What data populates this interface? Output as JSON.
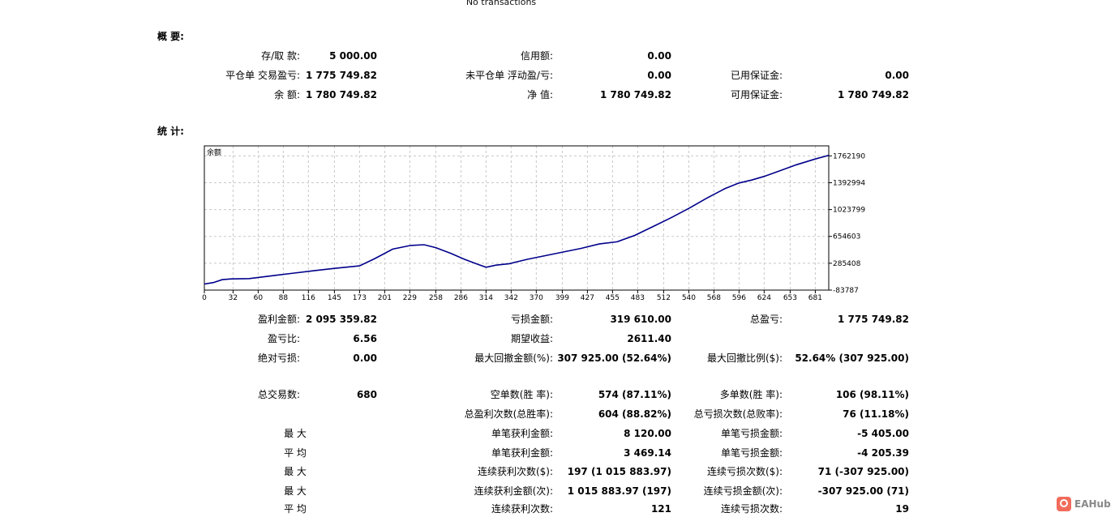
{
  "top_note": "No transactions",
  "summary": {
    "title": "概 要:",
    "rows": [
      [
        {
          "label": "存/取 款:",
          "value": "5 000.00"
        },
        {
          "label": "信用额:",
          "value": "0.00"
        },
        {
          "label": "",
          "value": ""
        }
      ],
      [
        {
          "label": "平仓单 交易盈亏:",
          "value": "1 775 749.82"
        },
        {
          "label": "未平仓单 浮动盈/亏:",
          "value": "0.00"
        },
        {
          "label": "已用保证金:",
          "value": "0.00"
        }
      ],
      [
        {
          "label": "余 额:",
          "value": "1 780 749.82"
        },
        {
          "label": "净 值:",
          "value": "1 780 749.82"
        },
        {
          "label": "可用保证金:",
          "value": "1 780 749.82"
        }
      ]
    ]
  },
  "stats": {
    "title": "统 计:",
    "rows": [
      [
        {
          "label": "盈利金额:",
          "value": "2 095 359.82"
        },
        {
          "label": "亏损金额:",
          "value": "319 610.00"
        },
        {
          "label": "总盈亏:",
          "value": "1 775 749.82"
        }
      ],
      [
        {
          "label": "盈亏比:",
          "value": "6.56"
        },
        {
          "label": "期望收益:",
          "value": "2611.40"
        },
        {
          "label": "",
          "value": ""
        }
      ],
      [
        {
          "label": "绝对亏损:",
          "value": "0.00"
        },
        {
          "label": "最大回撤金额(%):",
          "value": "307 925.00 (52.64%)"
        },
        {
          "label": "最大回撤比例($):",
          "value": "52.64% (307 925.00)"
        }
      ],
      [
        {
          "label": "总交易数:",
          "value": "680"
        },
        {
          "label": "空单数(胜 率):",
          "value": "574 (87.11%)"
        },
        {
          "label": "多单数(胜 率):",
          "value": "106 (98.11%)"
        }
      ],
      [
        {
          "label": "",
          "value": ""
        },
        {
          "label": "总盈利次数(总胜率):",
          "value": "604 (88.82%)"
        },
        {
          "label": "总亏损次数(总败率):",
          "value": "76 (11.18%)"
        }
      ],
      [
        {
          "label": "最 大",
          "value": ""
        },
        {
          "label": "单笔获利金额:",
          "value": "8 120.00"
        },
        {
          "label": "单笔亏损金额:",
          "value": "-5 405.00"
        }
      ],
      [
        {
          "label": "平 均",
          "value": ""
        },
        {
          "label": "单笔获利金额:",
          "value": "3 469.14"
        },
        {
          "label": "单笔亏损金额:",
          "value": "-4 205.39"
        }
      ],
      [
        {
          "label": "最 大",
          "value": ""
        },
        {
          "label": "连续获利次数($):",
          "value": "197 (1 015 883.97)"
        },
        {
          "label": "连续亏损次数($):",
          "value": "71 (-307 925.00)"
        }
      ],
      [
        {
          "label": "最 大",
          "value": ""
        },
        {
          "label": "连续获利金额(次):",
          "value": "1 015 883.97 (197)"
        },
        {
          "label": "连续亏损金额(次):",
          "value": "-307 925.00 (71)"
        }
      ],
      [
        {
          "label": "平 均",
          "value": ""
        },
        {
          "label": "连续获利次数:",
          "value": "121"
        },
        {
          "label": "连续亏损次数:",
          "value": "19"
        }
      ]
    ]
  },
  "chart_data": {
    "type": "line",
    "title": "余额",
    "x_ticks": [
      0,
      32,
      60,
      88,
      116,
      145,
      173,
      201,
      229,
      258,
      286,
      314,
      342,
      370,
      399,
      427,
      455,
      483,
      512,
      540,
      568,
      596,
      624,
      653,
      681
    ],
    "y_ticks": [
      1762190,
      1392994,
      1023799,
      654603,
      285408,
      -83787
    ],
    "xlim": [
      0,
      696
    ],
    "ylim": [
      -83787,
      1900000
    ],
    "grid": true,
    "colors": {
      "line": "#00008b",
      "grid": "#c8c8c8",
      "frame": "#000000"
    },
    "series": [
      {
        "x": [
          0,
          10,
          20,
          30,
          50,
          60,
          80,
          100,
          120,
          145,
          173,
          190,
          210,
          230,
          245,
          258,
          275,
          290,
          305,
          314,
          325,
          340,
          360,
          380,
          400,
          420,
          440,
          460,
          480,
          500,
          520,
          540,
          560,
          580,
          596,
          610,
          624,
          640,
          660,
          681,
          696
        ],
        "y": [
          0,
          20000,
          60000,
          70000,
          75000,
          90000,
          120000,
          150000,
          180000,
          215000,
          250000,
          350000,
          480000,
          530000,
          540000,
          500000,
          420000,
          340000,
          270000,
          230000,
          260000,
          280000,
          340000,
          390000,
          440000,
          490000,
          550000,
          580000,
          670000,
          790000,
          910000,
          1040000,
          1180000,
          1310000,
          1390000,
          1430000,
          1480000,
          1550000,
          1640000,
          1720000,
          1770000
        ]
      }
    ]
  },
  "watermark": {
    "text": "EAHub",
    "icon": "eahub-logo-icon"
  }
}
